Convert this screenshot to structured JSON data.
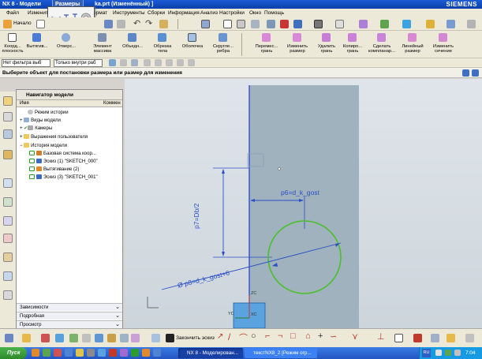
{
  "window": {
    "title_left": "NX 8 - Модели",
    "title_right": "ka.prt (Изменённый) ]",
    "vendor": "SIEMENS",
    "popup_tab": "Размеры"
  },
  "menu": [
    "Файл",
    "Изменить",
    "ормат",
    "Инструменты",
    "Сборки",
    "Информация",
    "Анализ",
    "Настройки",
    "Окно",
    "Помощь"
  ],
  "toolbar1": {
    "start_label": "Начало"
  },
  "toolbar2": {
    "items": [
      {
        "label": "Коорд... плоскость",
        "icon": "datum-plane-icon"
      },
      {
        "label": "Вытягив...",
        "icon": "extrude-icon"
      },
      {
        "label": "Отверс...",
        "icon": "hole-icon"
      },
      {
        "label": "Элемент массива",
        "icon": "pattern-feature-icon"
      },
      {
        "label": "Объедн...",
        "icon": "unite-icon"
      },
      {
        "label": "Обрезка тела",
        "icon": "trim-body-icon"
      },
      {
        "label": "Оболочка",
        "icon": "shell-icon"
      },
      {
        "label": "Скругле... ребра",
        "icon": "edge-blend-icon"
      },
      {
        "label": "Перемес... грань",
        "icon": "move-face-icon"
      },
      {
        "label": "Изменить размер",
        "icon": "resize-face-icon"
      },
      {
        "label": "Удалить грань",
        "icon": "delete-face-icon"
      },
      {
        "label": "Копиро... грань",
        "icon": "copy-face-icon"
      },
      {
        "label": "Сделать компланар...",
        "icon": "make-coplanar-icon"
      },
      {
        "label": "Линейный размер",
        "icon": "linear-dimension-icon"
      },
      {
        "label": "Изменить сечение",
        "icon": "edit-section-icon"
      }
    ]
  },
  "toolbar3": {
    "filter_value": "Нет фильтра выб",
    "scope_value": "Только внутри раб"
  },
  "cue_line": "Выберите объект для постановки размера или размер для изменения",
  "navigator": {
    "title": "Навигатор модели",
    "col_name": "Имя",
    "col_comment": "Коммен",
    "tree": [
      {
        "label": "Режим истории",
        "level": 1
      },
      {
        "label": "Виды модели",
        "level": 0
      },
      {
        "label": "Камеры",
        "level": 0
      },
      {
        "label": "Выражения пользователя",
        "level": 0
      },
      {
        "label": "История модели",
        "level": 0
      },
      {
        "label": "Базовая система коор...",
        "level": 1
      },
      {
        "label": "Эскиз (1) \"SKETCH_000\"",
        "level": 1
      },
      {
        "label": "Вытягивание (2)",
        "level": 1
      },
      {
        "label": "Эскиз (3) \"SKETCH_001\"",
        "level": 1
      }
    ],
    "sections": [
      "Зависимости",
      "Подробная",
      "Просмотр"
    ]
  },
  "sketch": {
    "dim_p6": "p6=d_k_gost",
    "dim_p7": "p7=Db/2",
    "dim_p8": "Ø p8=d_k_gost+6",
    "axis_xc": "XC",
    "axis_yc": "YC",
    "axis_zc": "ZC"
  },
  "bottom_toolbar": {
    "finish_sketch": "Закончить эскиз"
  },
  "taskbar": {
    "start": "Пуск",
    "tasks": [
      "NX 8 - Моделирован...",
      "текстNX8_2 [Режим огр..."
    ],
    "lang": "RU",
    "clock": "7:04"
  },
  "colors": {
    "title_bar": "#0a3fa8",
    "block_fill": "#9fb2bd",
    "dimension": "#2b4fc7",
    "circle": "#4cbf2c",
    "axis": "#1a3bd9"
  }
}
